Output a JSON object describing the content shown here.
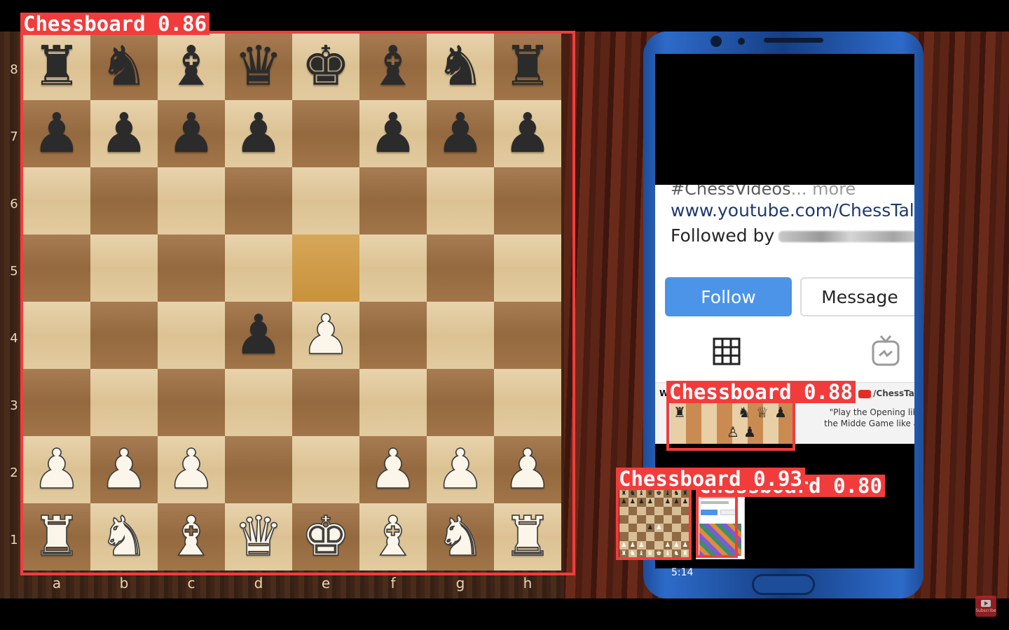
{
  "detections": [
    {
      "label": "Chessboard",
      "score": "0.86"
    },
    {
      "label": "Chessboard",
      "score": "0.88"
    },
    {
      "label": "Chessboard",
      "score": "0.93"
    },
    {
      "label": "Chessboard",
      "score": "0.80"
    }
  ],
  "board": {
    "ranks": [
      "8",
      "7",
      "6",
      "5",
      "4",
      "3",
      "2",
      "1"
    ],
    "files": [
      "a",
      "b",
      "c",
      "d",
      "e",
      "f",
      "g",
      "h"
    ],
    "pieces": [
      [
        "br",
        "bn",
        "bb",
        "bq",
        "bk",
        "bb",
        "bn",
        "br"
      ],
      [
        "bp",
        "bp",
        "bp",
        "bp",
        "",
        "bp",
        "bp",
        "bp"
      ],
      [
        "",
        "",
        "",
        "",
        "",
        "",
        "",
        ""
      ],
      [
        "",
        "",
        "",
        "",
        "",
        "",
        "",
        ""
      ],
      [
        "",
        "",
        "",
        "bp",
        "wp",
        "",
        "",
        ""
      ],
      [
        "",
        "",
        "",
        "",
        "",
        "",
        "",
        ""
      ],
      [
        "wp",
        "wp",
        "wp",
        "",
        "",
        "wp",
        "wp",
        "wp"
      ],
      [
        "wr",
        "wn",
        "wb",
        "wq",
        "wk",
        "wb",
        "wn",
        "wr"
      ]
    ],
    "highlighted": [
      "e5"
    ]
  },
  "phone": {
    "hashtag_text": "#ChessVideos",
    "more_text": "... more",
    "url": "www.youtube.com/ChessTalk",
    "followed_by": "Followed by",
    "follow_label": "Follow",
    "message_label": "Message",
    "thumb_prefix": "W",
    "thumb_channel": "/ChessTal",
    "thumb_quote": "\"Play the Opening like the Midde Game like a N"
  },
  "video": {
    "timestamp": "5:14",
    "subscribe_label": "Subscribe"
  },
  "colors": {
    "box": "#f23c3c",
    "follow": "#4b94e8",
    "phone_body": "#2d6bc9"
  }
}
